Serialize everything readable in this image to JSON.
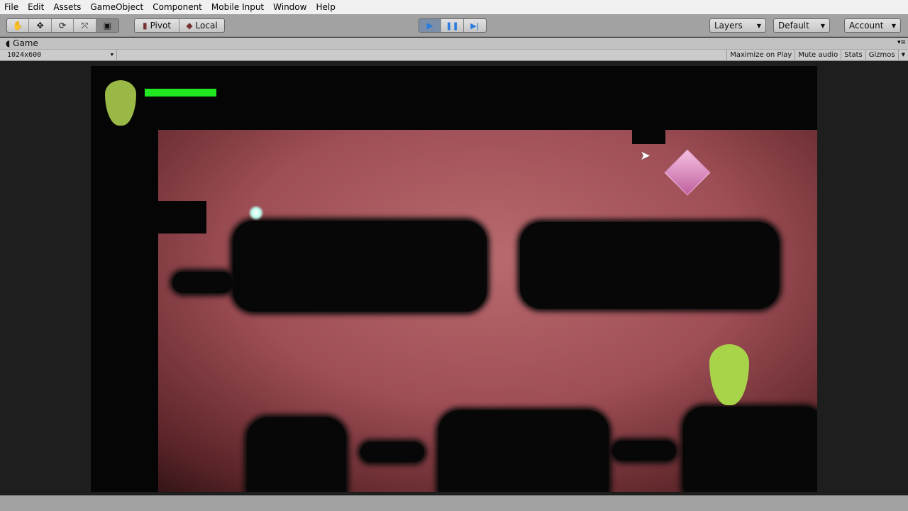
{
  "menu": [
    "File",
    "Edit",
    "Assets",
    "GameObject",
    "Component",
    "Mobile Input",
    "Window",
    "Help"
  ],
  "toolbar": {
    "tools": [
      {
        "name": "hand",
        "glyph": "✋"
      },
      {
        "name": "move",
        "glyph": "✥"
      },
      {
        "name": "rotate",
        "glyph": "⟳"
      },
      {
        "name": "scale",
        "glyph": "⤧"
      },
      {
        "name": "rect",
        "glyph": "▣"
      }
    ],
    "pivot": "Pivot",
    "local": "Local",
    "play": "▶",
    "pause": "❚❚",
    "step": "▶|",
    "layers": "Layers",
    "layout": "Default",
    "account": "Account",
    "play_color": "#3a7fd6"
  },
  "game": {
    "tab": "Game",
    "resolution": "1024x600",
    "options": [
      "Maximize on Play",
      "Mute audio",
      "Stats",
      "Gizmos"
    ],
    "health_fraction": 1.0,
    "health_color": "#22e622"
  }
}
